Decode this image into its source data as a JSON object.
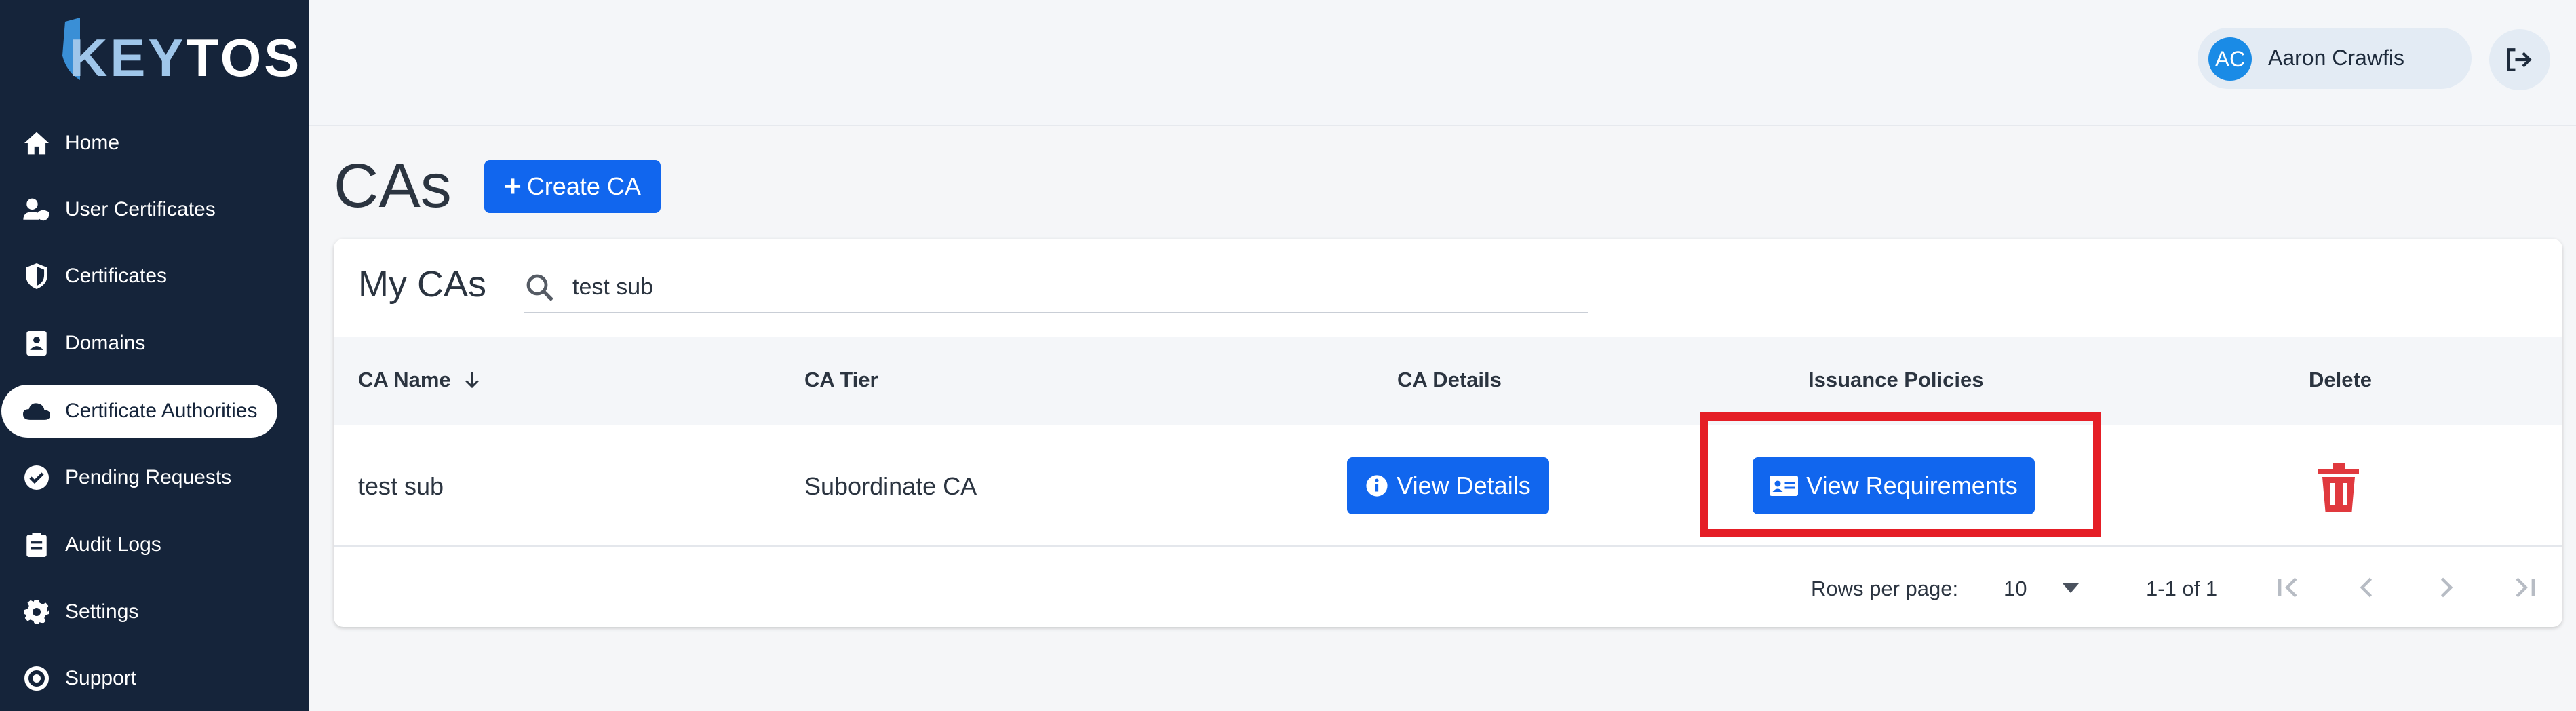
{
  "brand": {
    "name_part1": "KEY",
    "name_part2": "TOS"
  },
  "sidebar": {
    "items": [
      {
        "label": "Home",
        "icon": "home-icon"
      },
      {
        "label": "User Certificates",
        "icon": "user-cert-icon"
      },
      {
        "label": "Certificates",
        "icon": "shield-icon"
      },
      {
        "label": "Domains",
        "icon": "domain-icon"
      },
      {
        "label": "Certificate Authorities",
        "icon": "cloud-icon",
        "active": true
      },
      {
        "label": "Pending Requests",
        "icon": "check-circle-icon"
      },
      {
        "label": "Audit Logs",
        "icon": "clipboard-icon"
      },
      {
        "label": "Settings",
        "icon": "gear-icon"
      },
      {
        "label": "Support",
        "icon": "lifebuoy-icon"
      }
    ]
  },
  "user": {
    "initials": "AC",
    "name": "Aaron Crawfis"
  },
  "page": {
    "title": "CAs",
    "create_label": "Create CA"
  },
  "card": {
    "title": "My CAs",
    "search_value": "test sub",
    "columns": [
      "CA Name",
      "CA Tier",
      "CA Details",
      "Issuance Policies",
      "Delete"
    ],
    "rows": [
      {
        "name": "test sub",
        "tier": "Subordinate CA",
        "details_label": "View Details",
        "policies_label": "View Requirements"
      }
    ],
    "footer": {
      "rows_per_page_label": "Rows per page:",
      "rows_per_page_value": "10",
      "range": "1-1 of 1"
    }
  },
  "colors": {
    "sidebar": "#15243a",
    "primary": "#1166ee",
    "highlight": "#e51e26",
    "danger": "#e0393e"
  }
}
